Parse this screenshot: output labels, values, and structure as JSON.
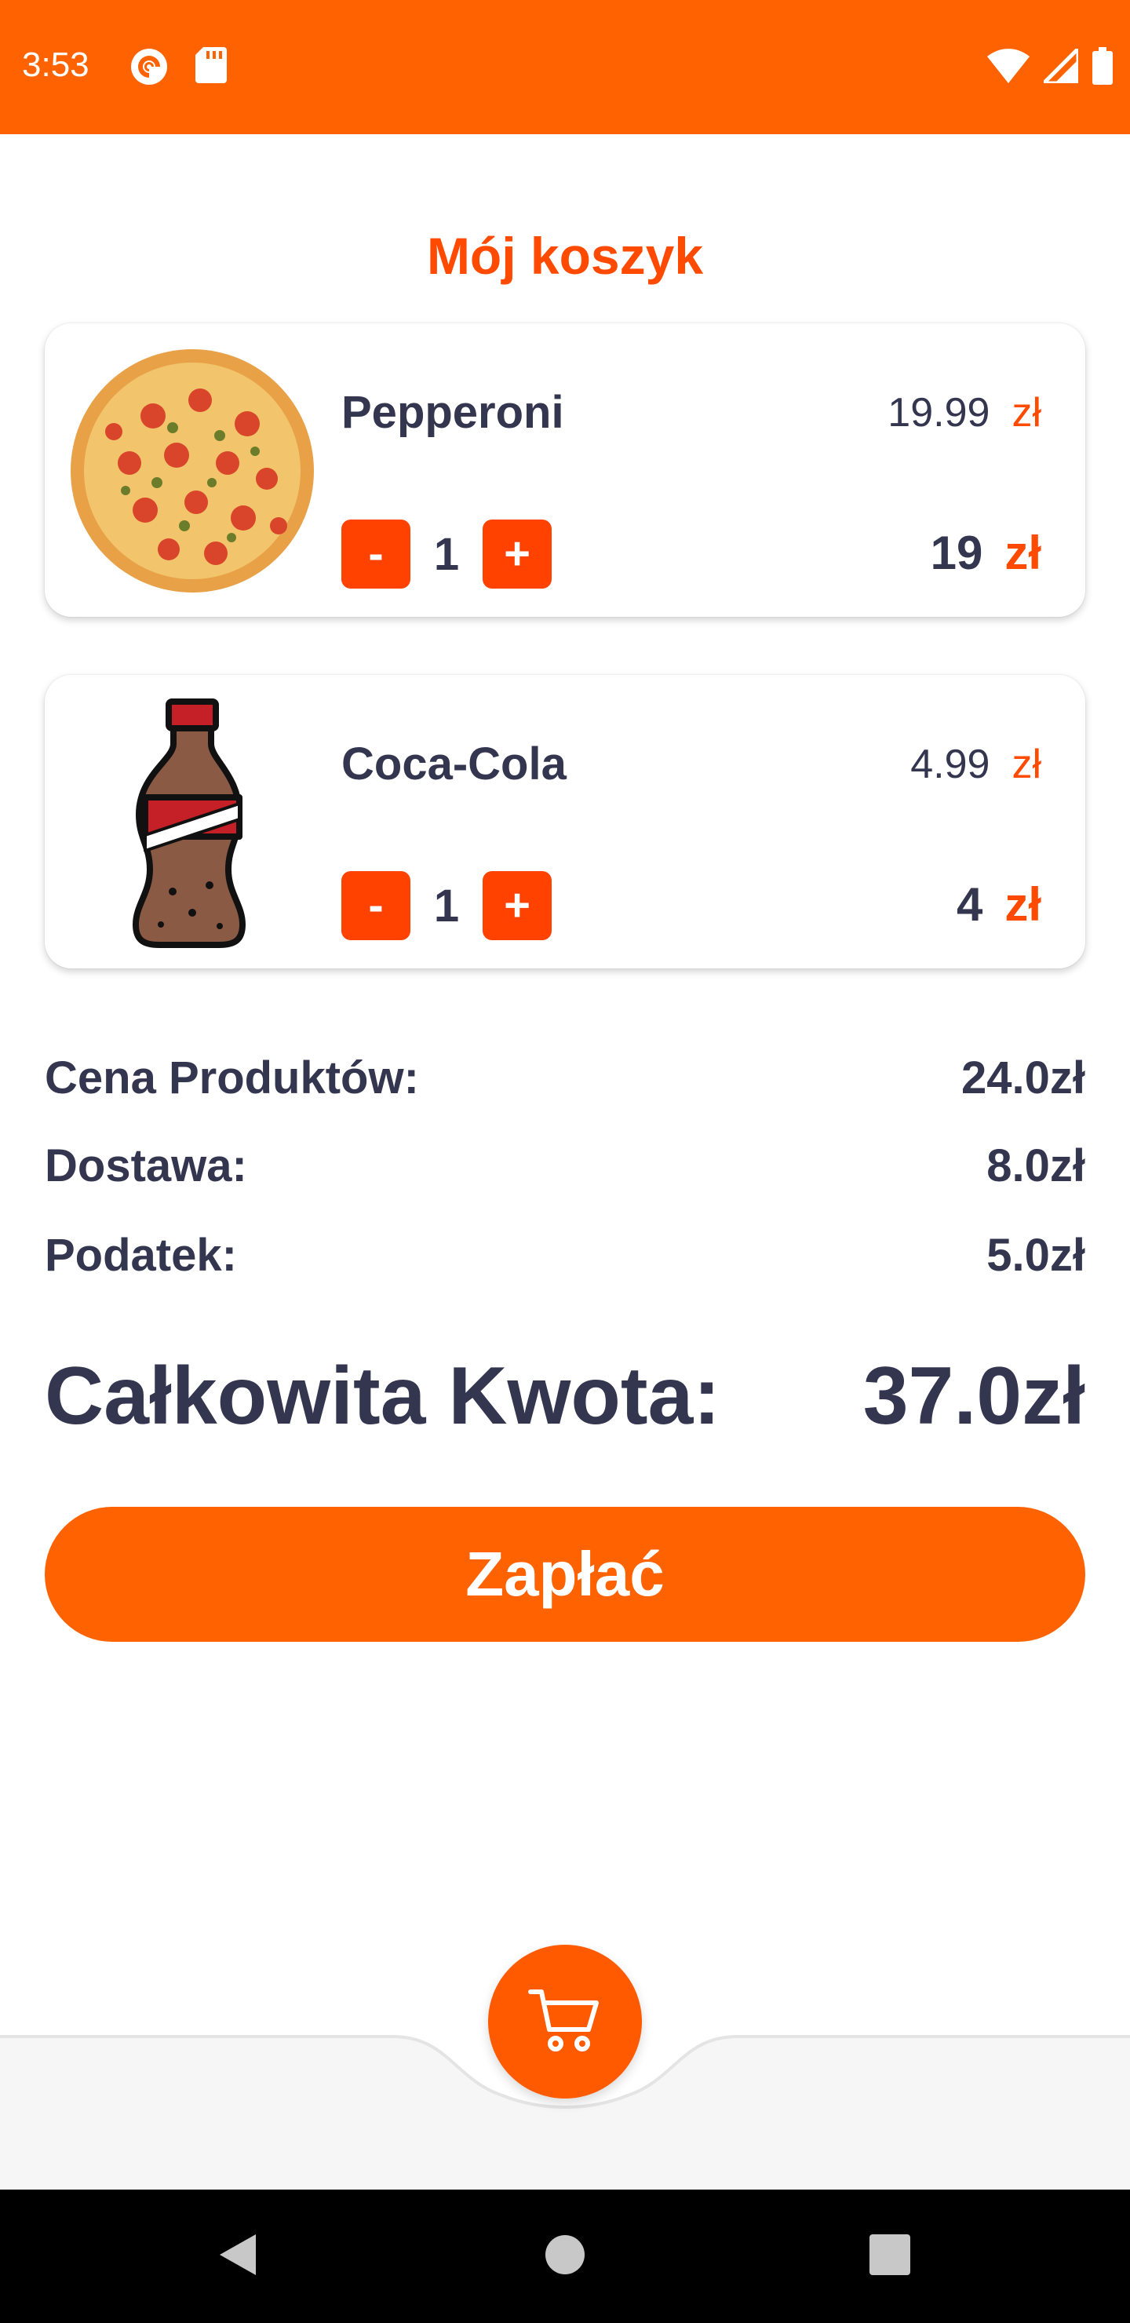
{
  "status_bar": {
    "time": "3:53",
    "left_icons": [
      "pocket-casts-icon",
      "sd-card-icon"
    ],
    "right_icons": [
      "wifi-icon",
      "signal-icon",
      "battery-icon"
    ]
  },
  "page_title": "Mój koszyk",
  "cart_items": [
    {
      "name": "Pepperoni",
      "unit_price": "19.99",
      "currency": "zł",
      "quantity": "1",
      "line_total": "19",
      "minus": "-",
      "plus": "+",
      "image": "pizza-image"
    },
    {
      "name": "Coca-Cola",
      "unit_price": "4.99",
      "currency": "zł",
      "quantity": "1",
      "line_total": "4",
      "minus": "-",
      "plus": "+",
      "image": "cola-bottle-image"
    }
  ],
  "summary": {
    "products_label": "Cena Produktów:",
    "products_value": "24.0zł",
    "delivery_label": "Dostawa:",
    "delivery_value": "8.0zł",
    "tax_label": "Podatek:",
    "tax_value": "5.0zł",
    "total_label": "Całkowita Kwota:",
    "total_value": "37.0zł"
  },
  "pay_button": "Zapłać",
  "bottom_nav": {
    "fab_icon": "cart-icon"
  },
  "system_nav": [
    "back-icon",
    "home-icon",
    "recents-icon"
  ],
  "colors": {
    "accent": "#ff6200",
    "accent_dark": "#ff4200",
    "text": "#343650"
  }
}
